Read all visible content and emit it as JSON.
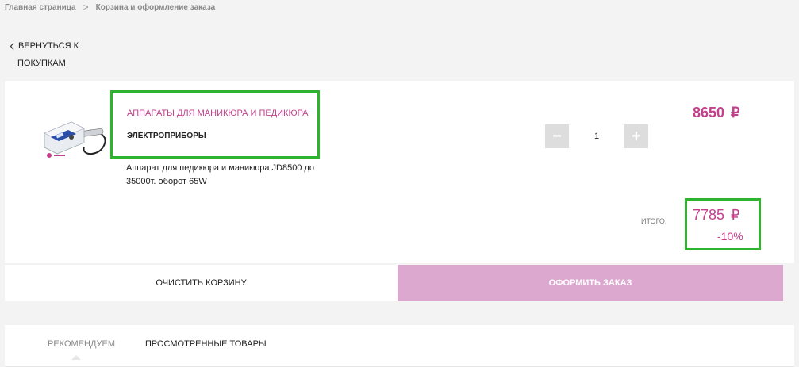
{
  "breadcrumb": {
    "home": "Главная страница",
    "current": "Корзина и оформление заказа"
  },
  "back": {
    "line1": "ВЕРНУТЬСЯ К",
    "line2": "ПОКУПКАМ"
  },
  "cart": {
    "item": {
      "category": "АППАРАТЫ ДЛЯ МАНИКЮРА И ПЕДИКЮРА",
      "subcategory": "ЭЛЕКТРОПРИБОРЫ",
      "description": "Аппарат для педикюра и маникюра JD8500 до 35000т. оборот 65W",
      "quantity": "1",
      "price": "8650",
      "currency": "₽"
    },
    "total_label": "ИТОГО:",
    "total": "7785",
    "discount": "-10%"
  },
  "actions": {
    "clear": "ОЧИСТИТЬ КОРЗИНУ",
    "checkout": "ОФОРМИТЬ ЗАКАЗ"
  },
  "tabs": {
    "recommend": "РЕКОМЕНДУЕМ",
    "viewed": "ПРОСМОТРЕННЫЕ ТОВАРЫ"
  },
  "colors": {
    "accent": "#c2408c",
    "highlight": "#2db32d",
    "checkout_bg": "#dca8cf"
  },
  "icons": {
    "back": "chevron-left-icon",
    "breadcrumb_sep": "chevron-right-icon",
    "minus": "minus-icon",
    "plus": "plus-icon"
  }
}
